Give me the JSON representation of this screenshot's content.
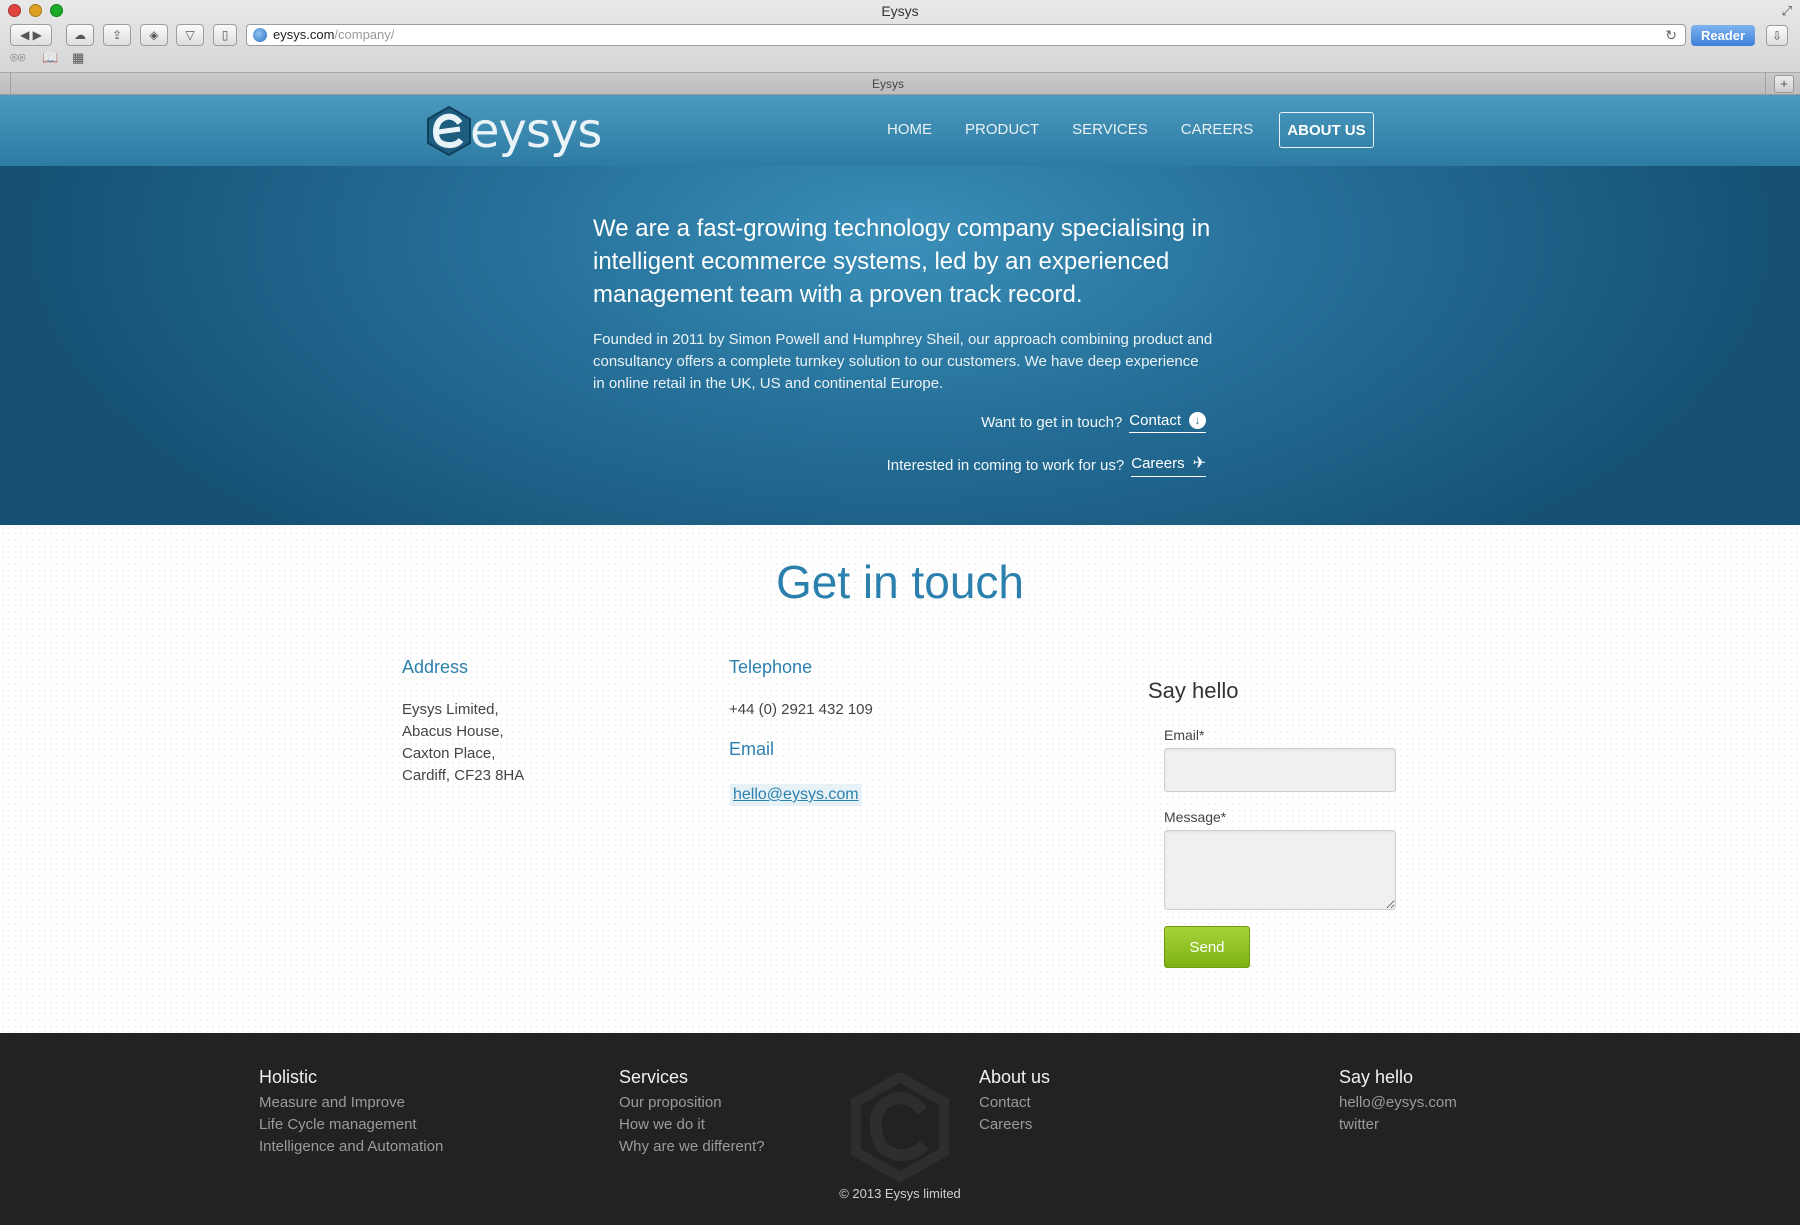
{
  "browser": {
    "window_title": "Eysys",
    "url_host": "eysys.com",
    "url_path": "/company/",
    "reader_label": "Reader",
    "tab_title": "Eysys",
    "new_tab_label": "+"
  },
  "site": {
    "logo_text": "eysys",
    "nav": [
      {
        "label": "HOME"
      },
      {
        "label": "PRODUCT"
      },
      {
        "label": "SERVICES"
      },
      {
        "label": "CAREERS"
      },
      {
        "label": "ABOUT US",
        "active": true
      }
    ]
  },
  "hero": {
    "lead": "We are a fast-growing technology company specialising in intelligent ecommerce systems, led by an experienced management team with a proven track record.",
    "sub": "Founded in 2011 by Simon Powell and Humphrey Sheil, our approach combining product and consultancy offers a complete turnkey solution to our customers. We have deep experience in online retail in the UK, US and continental Europe.",
    "cta_contact_text": "Want to get in touch?",
    "cta_contact_link": "Contact",
    "cta_careers_text": "Interested in coming to work for us?",
    "cta_careers_link": "Careers"
  },
  "contact": {
    "title": "Get in touch",
    "address_heading": "Address",
    "address_lines": [
      "Eysys Limited,",
      "Abacus House,",
      "Caxton Place,",
      "Cardiff, CF23 8HA"
    ],
    "telephone_heading": "Telephone",
    "telephone": "+44 (0) 2921 432 109",
    "email_heading": "Email",
    "email": "hello@eysys.com",
    "form": {
      "heading": "Say hello",
      "email_label": "Email*",
      "email_value": "",
      "message_label": "Message*",
      "message_value": "",
      "send_label": "Send"
    }
  },
  "footer": {
    "columns": [
      {
        "heading": "Holistic",
        "links": [
          "Measure and Improve",
          "Life Cycle management",
          "Intelligence and Automation"
        ]
      },
      {
        "heading": "Services",
        "links": [
          "Our proposition",
          "How we do it",
          "Why are we different?"
        ]
      },
      {
        "heading": "About us",
        "links": [
          "Contact",
          "Careers"
        ]
      },
      {
        "heading": "Say hello",
        "links": [
          "hello@eysys.com",
          "twitter"
        ]
      }
    ],
    "copyright": "© 2013 Eysys limited"
  },
  "colors": {
    "accent": "#2c80ad",
    "header": "#3a8ab2",
    "hero_dark": "#154f73",
    "send_button": "#8fc323",
    "footer_bg": "#222222"
  },
  "icons": [
    "back-icon",
    "forward-icon",
    "cloud-icon",
    "share-icon",
    "layers-icon",
    "pocket-icon",
    "bookmark-icon",
    "globe-icon",
    "reload-icon",
    "download-icon",
    "reading-list-icon",
    "open-book-icon",
    "grid-icon",
    "arrow-down-circle-icon",
    "plane-icon"
  ]
}
